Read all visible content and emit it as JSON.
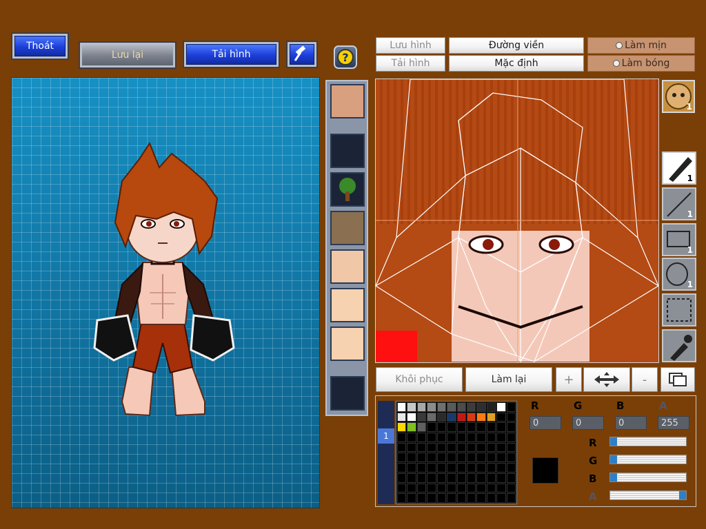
{
  "top_buttons": {
    "exit": "Thoát",
    "save": "Lưu lại",
    "load": "Tải hình",
    "help": "?"
  },
  "editor_toolbar": {
    "save_image": "Lưu hình",
    "load_image": "Tải hình",
    "outline": "Đường viền",
    "default": "Mặc định",
    "smooth": "Làm mịn",
    "shade": "Làm bóng"
  },
  "action_buttons": {
    "restore": "Khôi phục",
    "redo": "Làm lại",
    "plus": "+",
    "minus": "-"
  },
  "tools": {
    "pen_count": "1",
    "line_count": "1",
    "rect_count": "1",
    "ellipse_count": "1",
    "face_count": "1"
  },
  "color": {
    "r_label": "R",
    "g_label": "G",
    "b_label": "B",
    "a_label": "A",
    "r": "0",
    "g": "0",
    "b": "0",
    "a": "255",
    "current_color": "#000000",
    "r_slider": 0,
    "g_slider": 0,
    "b_slider": 0,
    "a_slider": 1
  },
  "palette_tab": "1",
  "palette_colors": [
    "#ffffff",
    "#c8c8c8",
    "#a8a8a8",
    "#8c8c8c",
    "#707070",
    "#5a5a5a",
    "#4c4c4c",
    "#3c3c3c",
    "#2e2e2e",
    "#202020",
    "#ffffff",
    "#000000",
    "#e8e8e8",
    "#ffffff",
    "#3a3a3a",
    "#6a6a6a",
    "#2a2a2a",
    "#1a3a6a",
    "#c01818",
    "#d83a10",
    "#ff7a10",
    "#e0a020",
    "#000000",
    "#000000",
    "#ffd800",
    "#80c020",
    "#606060"
  ]
}
